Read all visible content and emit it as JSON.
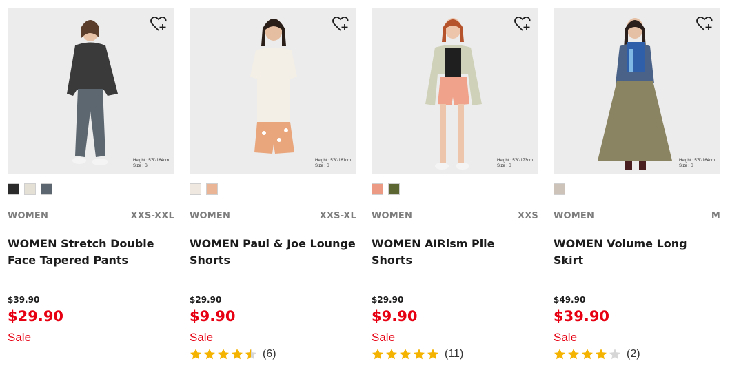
{
  "products": [
    {
      "height_note": [
        "Height : 5'5\"/164cm",
        "Size : S"
      ],
      "swatch_colors": [
        "#2b2b2b",
        "#e4e0d6",
        "#5b6670"
      ],
      "category": "WOMEN",
      "sizes": "XXS-XXL",
      "name": "WOMEN Stretch Double Face Tapered Pants",
      "original_price": "$39.90",
      "price": "$29.90",
      "flag": "Sale",
      "rating": null,
      "review_count": ""
    },
    {
      "height_note": [
        "Height : 5'3\"/161cm",
        "Size : S"
      ],
      "swatch_colors": [
        "#efe8e0",
        "#eab497"
      ],
      "category": "WOMEN",
      "sizes": "XXS-XL",
      "name": "WOMEN Paul & Joe Lounge Shorts",
      "original_price": "$29.90",
      "price": "$9.90",
      "flag": "Sale",
      "rating": 4.5,
      "review_count": "(6)"
    },
    {
      "height_note": [
        "Height : 5'8\"/173cm",
        "Size : S"
      ],
      "swatch_colors": [
        "#ec9a84",
        "#5c6632"
      ],
      "category": "WOMEN",
      "sizes": "XXS",
      "name": "WOMEN AIRism Pile Shorts",
      "original_price": "$29.90",
      "price": "$9.90",
      "flag": "Sale",
      "rating": 5,
      "review_count": "(11)"
    },
    {
      "height_note": [
        "Height : 5'5\"/164cm",
        "Size : S"
      ],
      "swatch_colors": [
        "#cdc3b8"
      ],
      "category": "WOMEN",
      "sizes": "M",
      "name": "WOMEN Volume Long Skirt",
      "original_price": "$49.90",
      "price": "$39.90",
      "flag": "Sale",
      "rating": 4,
      "review_count": "(2)"
    }
  ],
  "colors": {
    "sale": "#e60012",
    "star": "#f5b301",
    "star_empty": "#d6d6d6"
  },
  "icons": {
    "favorite": "heart-plus-icon",
    "star": "star-icon"
  }
}
